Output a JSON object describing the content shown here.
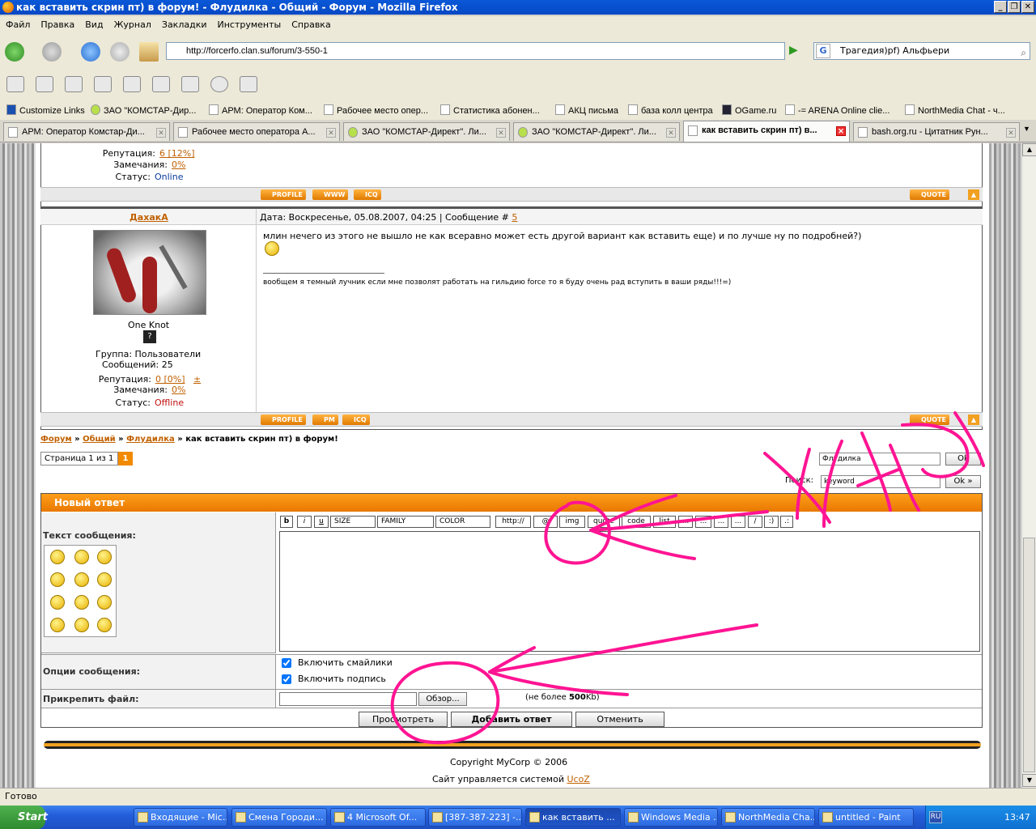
{
  "window": {
    "title": "как вставить скрин пт) в форум! - Флудилка - Общий - Форум - Mozilla Firefox",
    "btn_min": "_",
    "btn_max": "❐",
    "btn_close": "✕"
  },
  "menu": [
    "Файл",
    "Правка",
    "Вид",
    "Журнал",
    "Закладки",
    "Инструменты",
    "Справка"
  ],
  "nav": {
    "url": "http://forcerfo.clan.su/forum/3-550-1",
    "search_value": "Трагедия)pf) Альфьери",
    "search_engine_label": "G"
  },
  "bookmarks": [
    "Customize Links",
    "ЗАО \"КОМСТАР-Дир...",
    "АРМ: Оператор Ком...",
    "Рабочее место опер...",
    "Статистика абонен...",
    "АКЦ письма",
    "база колл центра",
    "OGame.ru",
    "-= ARENA Online clie...",
    "NorthMedia Chat - ч..."
  ],
  "tabs": [
    "АРМ: Оператор Комстар-Ди...",
    "Рабочее место оператора А...",
    "ЗАО \"КОМСТАР-Директ\". Ли...",
    "ЗАО \"КОМСТАР-Директ\". Ли...",
    "как вставить скрин пт) в...",
    "bash.org.ru - Цитатник Рун..."
  ],
  "prev_post": {
    "rep_label": "Репутация:",
    "rep_value": "6 [12%]",
    "warn_label": "Замечания:",
    "warn_value": "0%",
    "status_label": "Статус:",
    "status_value": "Online",
    "buttons": [
      "PROFILE",
      "WWW",
      "ICQ"
    ],
    "quote": "QUOTE"
  },
  "post": {
    "author": "ДахакА",
    "header": "Дата: Воскресенье, 05.08.2007, 04:25 | Сообщение #",
    "msg_num": "5",
    "text": "млин нечего из этого не вышло не как всеравно может есть другой вариант как вставить еще) и по лучше ну по подробней?)",
    "signature": "вообщем я темный лучник если мне позволят работать на гильдию force то я буду очень рад вступить в ваши ряды!!!=)",
    "rank": "One Knot",
    "rank_icon": "?",
    "group": "Группа: Пользователи",
    "messages": "Сообщений: 25",
    "rep_label": "Репутация:",
    "rep_value": "0 [0%]",
    "rep_plusminus": "±",
    "warn_label": "Замечания:",
    "warn_value": "0%",
    "status_label": "Статус:",
    "status_value": "Offline",
    "buttons": [
      "PROFILE",
      "PM",
      "ICQ"
    ],
    "quote": "QUOTE"
  },
  "breadcrumb": {
    "forum": "Форум",
    "sep": "»",
    "general": "Общий",
    "flood": "Флудилка",
    "topic": "» как вставить скрин пт) в форум!"
  },
  "pagination": {
    "label": "Страница 1 из 1",
    "current": "1"
  },
  "jump": {
    "value": "Флудилка",
    "ok": "Ok"
  },
  "search": {
    "label": "Поиск:",
    "value": "keyword",
    "ok": "Ok »"
  },
  "reply": {
    "title": "Новый ответ",
    "text_label": "Текст сообщения:",
    "toolbar": [
      "b",
      "i",
      "u",
      "SIZE",
      "FAMILY",
      "COLOR",
      "http://",
      "@",
      "img",
      "quote",
      "code",
      "list",
      "...",
      "...",
      "...",
      "...",
      "/",
      ":)",
      ".:"
    ],
    "options_label": "Опции сообщения:",
    "opt_smilies": "Включить смайлики",
    "opt_signature": "Включить подпись",
    "attach_label": "Прикрепить файл:",
    "browse": "Обзор...",
    "limit_prefix": "(не более ",
    "limit_value": "500",
    "limit_suffix": "Kb)",
    "preview": "Просмотреть",
    "submit": "Добавить ответ",
    "cancel": "Отменить"
  },
  "footer": {
    "copyright": "Copyright MyCorp © 2006",
    "powered_prefix": "Сайт управляется системой ",
    "powered_link": "UcoZ"
  },
  "status": "Готово",
  "taskbar": {
    "start": "Start",
    "tasks": [
      "Входящие - Mic...",
      "Смена Городи...",
      "4 Microsoft Of...",
      "[387-387-223] -...",
      "как вставить ...",
      "Windows Media ...",
      "NorthMedia Cha...",
      "untitled - Paint"
    ],
    "lang": "RU",
    "clock": "13:47"
  },
  "colors": {
    "accent_orange": "#f18a00",
    "annotation_pink": "#ff1493"
  }
}
